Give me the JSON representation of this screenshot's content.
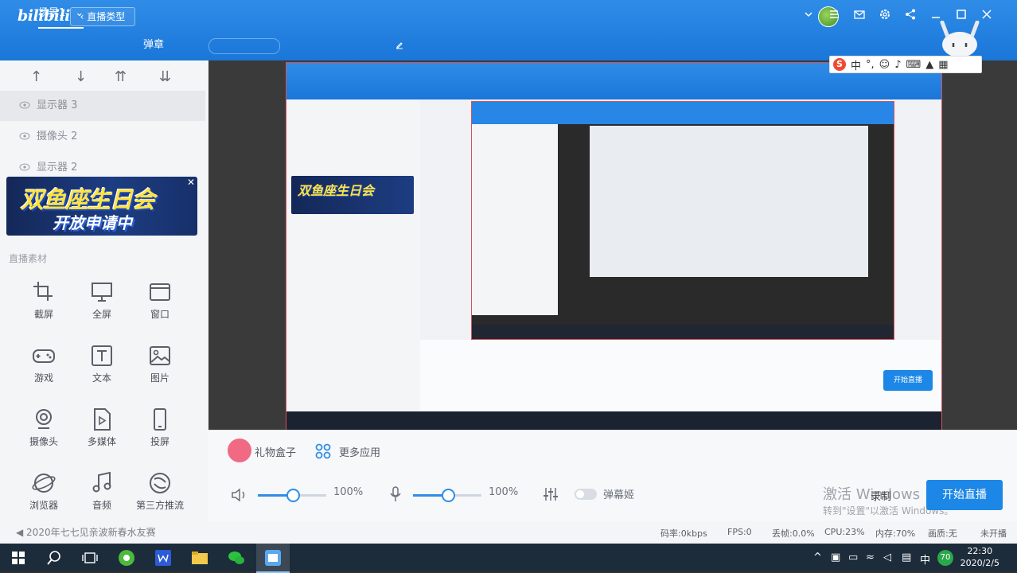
{
  "app": {
    "logo": "bilibili",
    "live_type_button": "直播类型",
    "tabs": [
      {
        "label": "场景1"
      },
      {
        "label": "弹章"
      }
    ]
  },
  "left": {
    "sources": [
      {
        "label": "显示器 3"
      },
      {
        "label": "摄像头 2"
      },
      {
        "label": "显示器 2"
      }
    ],
    "banner": {
      "line1": "双鱼座生日会",
      "line2": "开放申请中"
    },
    "section_title": "直播素材",
    "materials": [
      {
        "label": "截屏",
        "icon": "crop-icon"
      },
      {
        "label": "全屏",
        "icon": "monitor-icon"
      },
      {
        "label": "窗口",
        "icon": "window-icon"
      },
      {
        "label": "游戏",
        "icon": "gamepad-icon"
      },
      {
        "label": "文本",
        "icon": "text-icon"
      },
      {
        "label": "图片",
        "icon": "image-icon"
      },
      {
        "label": "摄像头",
        "icon": "webcam-icon"
      },
      {
        "label": "多媒体",
        "icon": "media-icon"
      },
      {
        "label": "投屏",
        "icon": "phone-cast-icon"
      },
      {
        "label": "浏览器",
        "icon": "browser-icon"
      },
      {
        "label": "音频",
        "icon": "music-icon"
      },
      {
        "label": "第三方推流",
        "icon": "stream-icon"
      }
    ],
    "ticker": "2020年七七见亲波新春水友赛"
  },
  "preview": {
    "ime_label": "中",
    "nested_start": "开始直播"
  },
  "controls": {
    "gift_label": "礼物盒子",
    "more_label": "更多应用",
    "volume": "100%",
    "volume_value": 0.5,
    "mic": "100%",
    "mic_value": 0.5,
    "danmaku_label": "弹幕姬",
    "record_label": "录制",
    "start_label": "开始直播",
    "watermark_line1": "激活 Windows",
    "watermark_line2": "转到\"设置\"以激活 Windows。"
  },
  "status": {
    "bitrate": "码率:0kbps",
    "fps": "FPS:0",
    "drop": "丢帧:0.0%",
    "cpu": "CPU:23%",
    "memory": "内存:70%",
    "quality": "画质:无",
    "live_state": "未开播"
  },
  "taskbar": {
    "ime": "中",
    "badge": "70",
    "time": "22:30",
    "date": "2020/2/5"
  },
  "colors": {
    "primary": "#1c87e6",
    "topbar": "#2f8de8",
    "gift": "#f06a83"
  }
}
